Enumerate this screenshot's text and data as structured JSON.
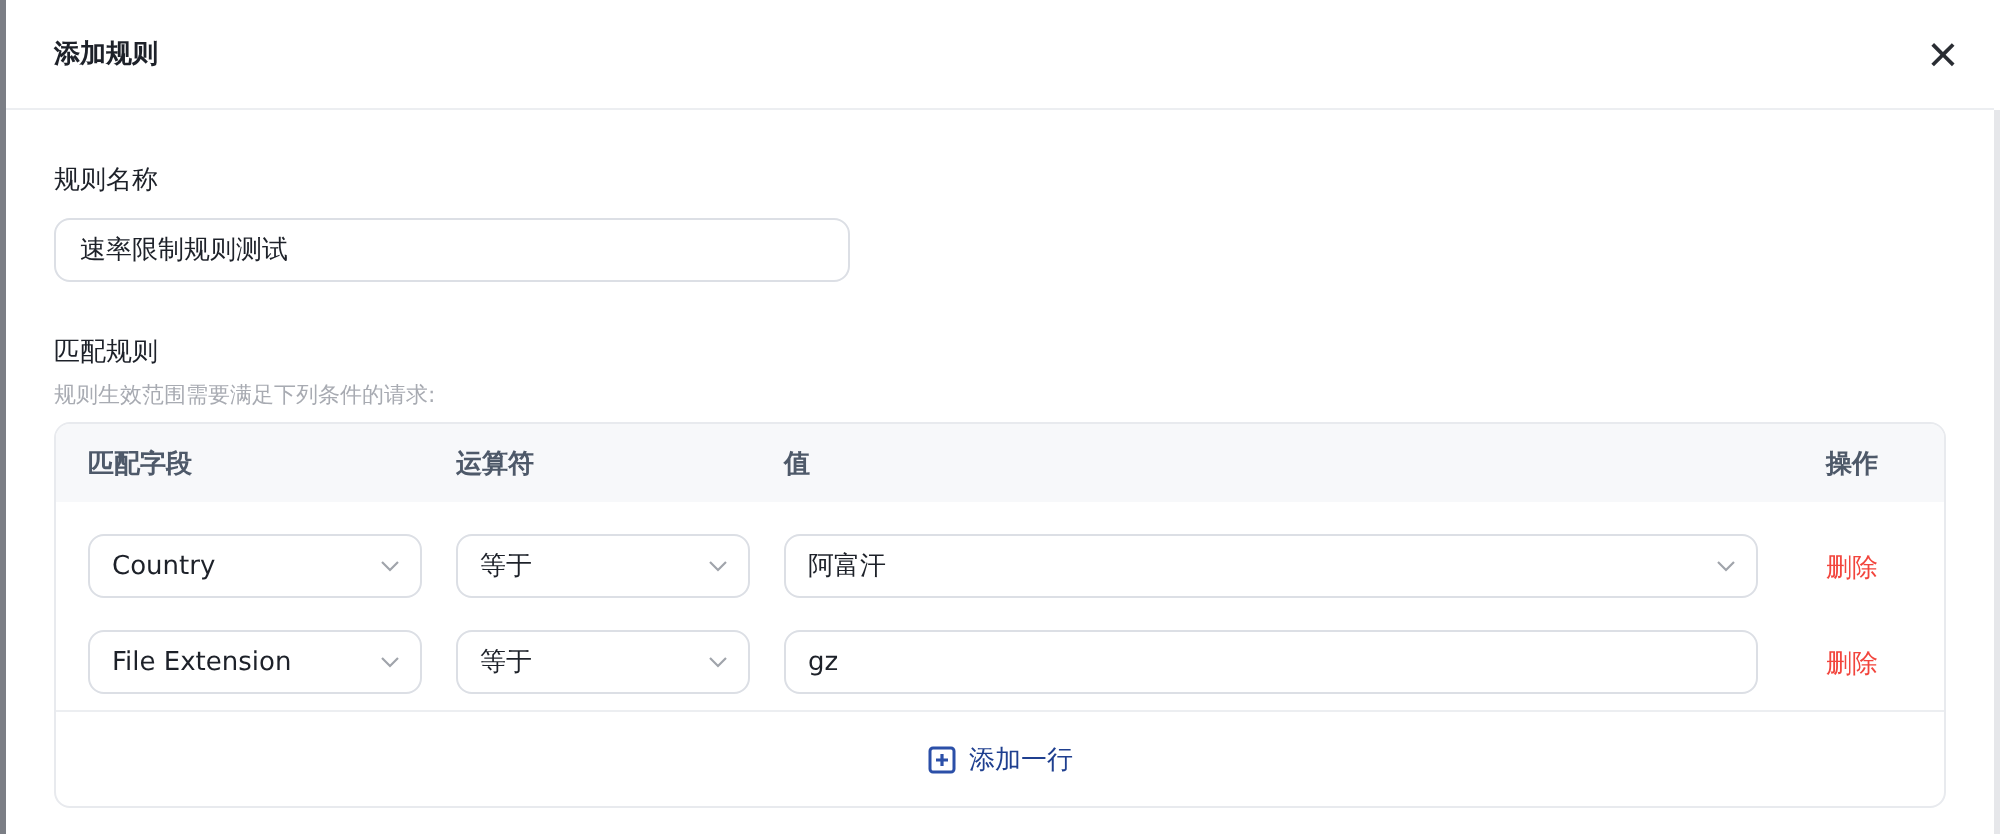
{
  "dialog": {
    "title": "添加规则",
    "close": "×"
  },
  "name_field": {
    "label": "规则名称",
    "value": "速率限制规则测试"
  },
  "match": {
    "label": "匹配规则",
    "hint": "规则生效范围需要满足下列条件的请求:",
    "columns": [
      "匹配字段",
      "运算符",
      "值",
      "操作"
    ],
    "rows": [
      {
        "field": "Country",
        "operator": "等于",
        "value": "阿富汗",
        "kind": "select",
        "action": "删除"
      },
      {
        "field": "File Extension",
        "operator": "等于",
        "value": "gz",
        "kind": "text",
        "action": "删除"
      }
    ],
    "add_row": "添加一行"
  }
}
